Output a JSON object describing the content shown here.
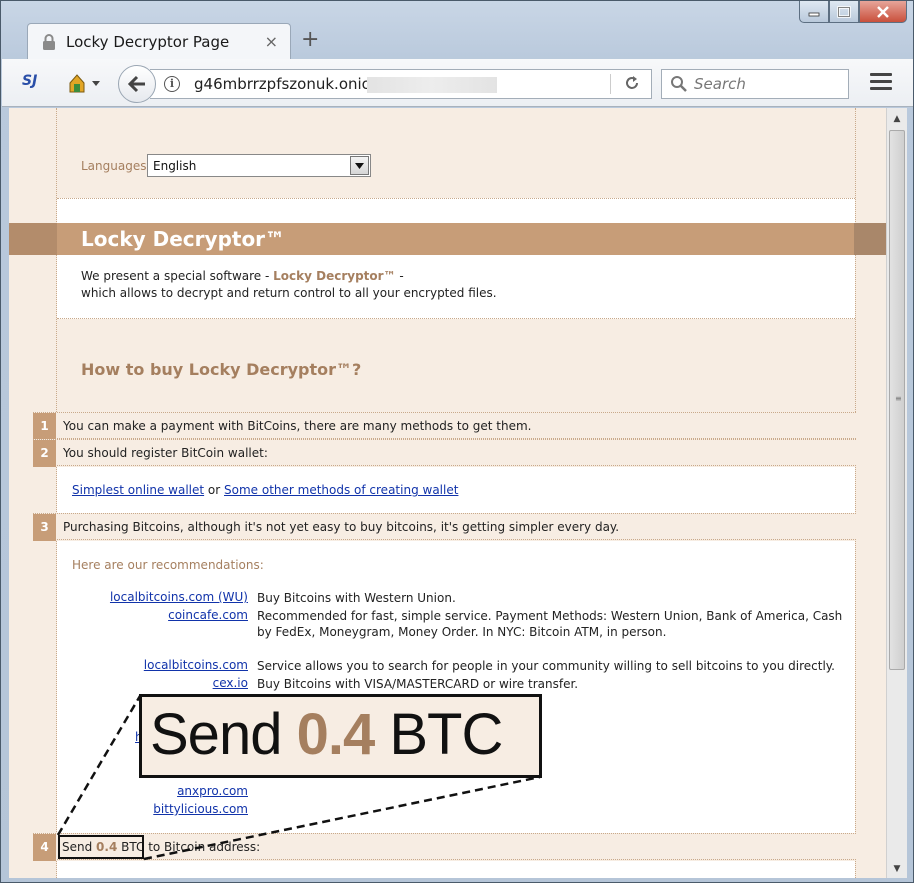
{
  "window": {
    "tab_title": "Locky Decryptor Page",
    "tab_close": "×",
    "newtab": "+"
  },
  "nav": {
    "extension_label": "SJ",
    "url": "g46mbrrzpfszonuk.onion/",
    "search_placeholder": "Search"
  },
  "page": {
    "languages_label": "Languages:",
    "language_selected": "English",
    "title": "Locky Decryptor™",
    "intro_line1_prefix": "We present a special software - ",
    "intro_line1_brand": "Locky Decryptor™",
    "intro_line1_suffix": " -",
    "intro_line2": "which allows to decrypt and return control to all your encrypted files.",
    "how_title": "How to buy Locky Decryptor™?",
    "steps": [
      {
        "num": "1",
        "text": "You can make a payment with BitCoins, there are many methods to get them."
      },
      {
        "num": "2",
        "text": "You should register BitCoin wallet:"
      },
      {
        "num": "3",
        "text": "Purchasing Bitcoins, although it's not yet easy to buy bitcoins, it's getting simpler every day."
      },
      {
        "num": "4",
        "text_prefix": "Send ",
        "amount": "0.4",
        "text_unit": " BTC",
        "text_suffix": " to Bitcoin address:"
      }
    ],
    "wallet_link1": "Simplest online wallet",
    "wallet_or": " or ",
    "wallet_link2": "Some other methods of creating wallet",
    "recommendations_label": "Here are our recommendations:",
    "recommendations": [
      {
        "link": "localbitcoins.com (WU)",
        "desc": "Buy Bitcoins with Western Union."
      },
      {
        "link": "coincafe.com",
        "desc": "Recommended for fast, simple service. Payment Methods: Western Union, Bank of America, Cash by FedEx, Moneygram, Money Order. In NYC: Bitcoin ATM, in person."
      },
      {
        "link": "localbitcoins.com",
        "desc": "Service allows you to search for people in your community willing to sell bitcoins to you directly."
      },
      {
        "link": "cex.io",
        "desc": "Buy Bitcoins with VISA/MASTERCARD or wire transfer."
      },
      {
        "link": "ho",
        "desc": ""
      },
      {
        "link": "anxpro.com",
        "desc": ""
      },
      {
        "link": "bittylicious.com",
        "desc": ""
      }
    ]
  },
  "callout": {
    "prefix": "Send ",
    "amount": "0.4",
    "unit": " BTC"
  },
  "colors": {
    "accent": "#c79d78",
    "accent_text": "#a57f5f",
    "page_bg": "#f7ede3",
    "link": "#1133aa"
  }
}
